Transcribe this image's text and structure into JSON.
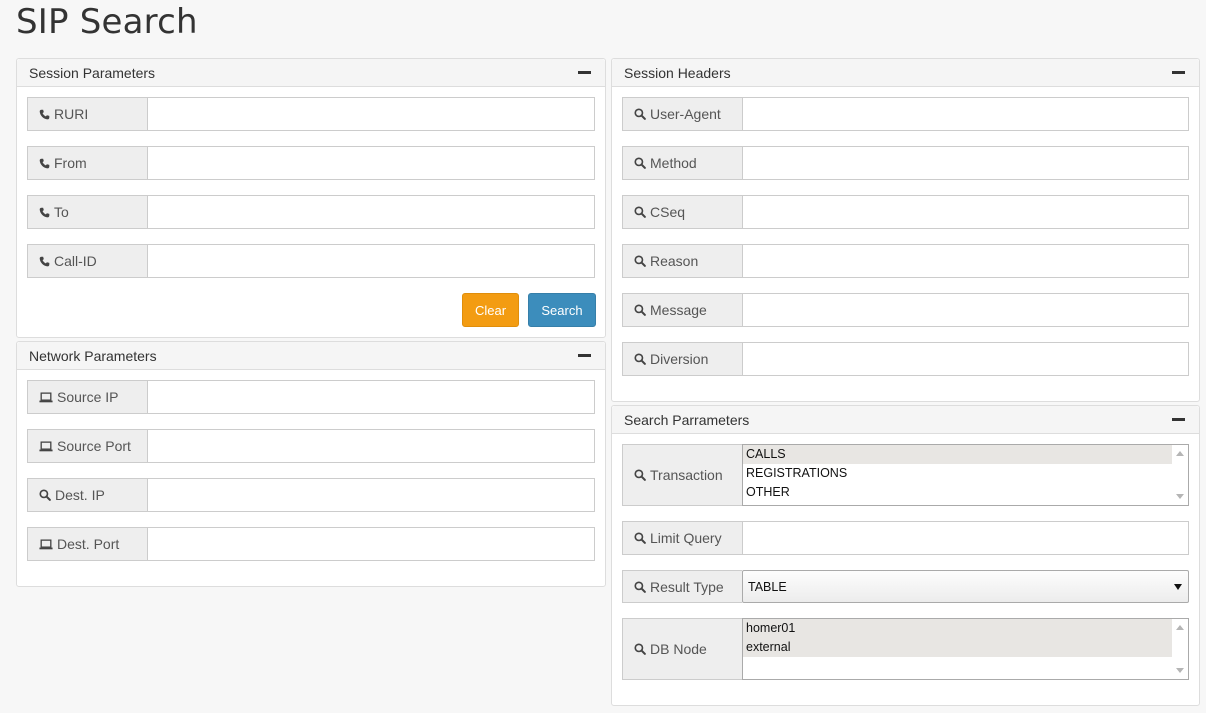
{
  "page": {
    "title": "SIP Search"
  },
  "session_parameters": {
    "title": "Session Parameters",
    "fields": [
      {
        "label": "RURI",
        "icon": "phone-icon",
        "value": ""
      },
      {
        "label": "From",
        "icon": "phone-icon",
        "value": ""
      },
      {
        "label": "To",
        "icon": "phone-icon",
        "value": ""
      },
      {
        "label": "Call-ID",
        "icon": "phone-icon",
        "value": ""
      }
    ],
    "clear_label": "Clear",
    "search_label": "Search"
  },
  "network_parameters": {
    "title": "Network Parameters",
    "fields": [
      {
        "label": "Source IP",
        "icon": "laptop-icon",
        "value": ""
      },
      {
        "label": "Source Port",
        "icon": "laptop-icon",
        "value": ""
      },
      {
        "label": "Dest. IP",
        "icon": "search-icon",
        "value": ""
      },
      {
        "label": "Dest. Port",
        "icon": "laptop-icon",
        "value": ""
      }
    ]
  },
  "session_headers": {
    "title": "Session Headers",
    "fields": [
      {
        "label": "User-Agent",
        "icon": "search-icon",
        "value": ""
      },
      {
        "label": "Method",
        "icon": "search-icon",
        "value": ""
      },
      {
        "label": "CSeq",
        "icon": "search-icon",
        "value": ""
      },
      {
        "label": "Reason",
        "icon": "search-icon",
        "value": ""
      },
      {
        "label": "Message",
        "icon": "search-icon",
        "value": ""
      },
      {
        "label": "Diversion",
        "icon": "search-icon",
        "value": ""
      }
    ]
  },
  "search_parameters": {
    "title": "Search Parrameters",
    "transaction": {
      "label": "Transaction",
      "options": [
        "CALLS",
        "REGISTRATIONS",
        "OTHER"
      ],
      "selected": [
        true,
        false,
        false
      ]
    },
    "limit_query": {
      "label": "Limit Query",
      "value": ""
    },
    "result_type": {
      "label": "Result Type",
      "selected": "TABLE"
    },
    "db_node": {
      "label": "DB Node",
      "options": [
        "homer01",
        "external"
      ],
      "selected": [
        true,
        true
      ]
    }
  },
  "colors": {
    "clear_button": "#f39c12",
    "search_button": "#3c8dbc",
    "panel_heading": "#f5f5f5",
    "addon_background": "#eeeeee"
  }
}
